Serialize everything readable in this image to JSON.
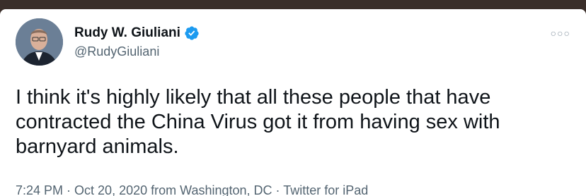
{
  "tweet": {
    "display_name": "Rudy W. Giuliani",
    "handle": "@RudyGiuliani",
    "text": "I think it's highly likely that all these people that have contracted the China Virus got it from having sex with barnyard animals.",
    "time": "7:24 PM",
    "separator1": " · ",
    "date": "Oct 20, 2020 from Washington, DC",
    "separator2": " · ",
    "source": "Twitter for iPad"
  },
  "icons": {
    "verified": "verified-badge-icon",
    "more": "more-options-icon"
  },
  "colors": {
    "text": "#0f1419",
    "secondary": "#536471",
    "verified": "#1d9bf0"
  }
}
